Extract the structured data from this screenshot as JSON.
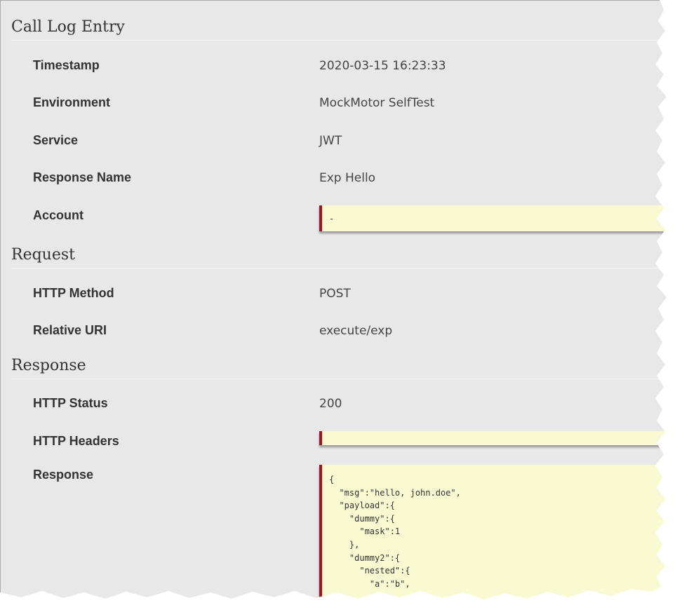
{
  "sections": {
    "call_log": {
      "title": "Call Log Entry",
      "timestamp": {
        "label": "Timestamp",
        "value": "2020-03-15 16:23:33"
      },
      "environment": {
        "label": "Environment",
        "value": "MockMotor SelfTest"
      },
      "service": {
        "label": "Service",
        "value": "JWT"
      },
      "response_name": {
        "label": "Response Name",
        "value": "Exp Hello"
      },
      "account": {
        "label": "Account",
        "value": "-"
      }
    },
    "request": {
      "title": "Request",
      "http_method": {
        "label": "HTTP Method",
        "value": "POST"
      },
      "relative_uri": {
        "label": "Relative URI",
        "value": "execute/exp"
      }
    },
    "response": {
      "title": "Response",
      "http_status": {
        "label": "HTTP Status",
        "value": "200"
      },
      "http_headers": {
        "label": "HTTP Headers",
        "value": ""
      },
      "response_body": {
        "label": "Response",
        "value": "{\n  \"msg\":\"hello, john.doe\",\n  \"payload\":{\n    \"dummy\":{\n      \"mask\":1\n    },\n    \"dummy2\":{\n      \"nested\":{\n        \"a\":\"b\","
      }
    }
  },
  "colors": {
    "background": "#e8e8e8",
    "highlight_box": "#fafad2",
    "box_accent": "#a3121c"
  }
}
